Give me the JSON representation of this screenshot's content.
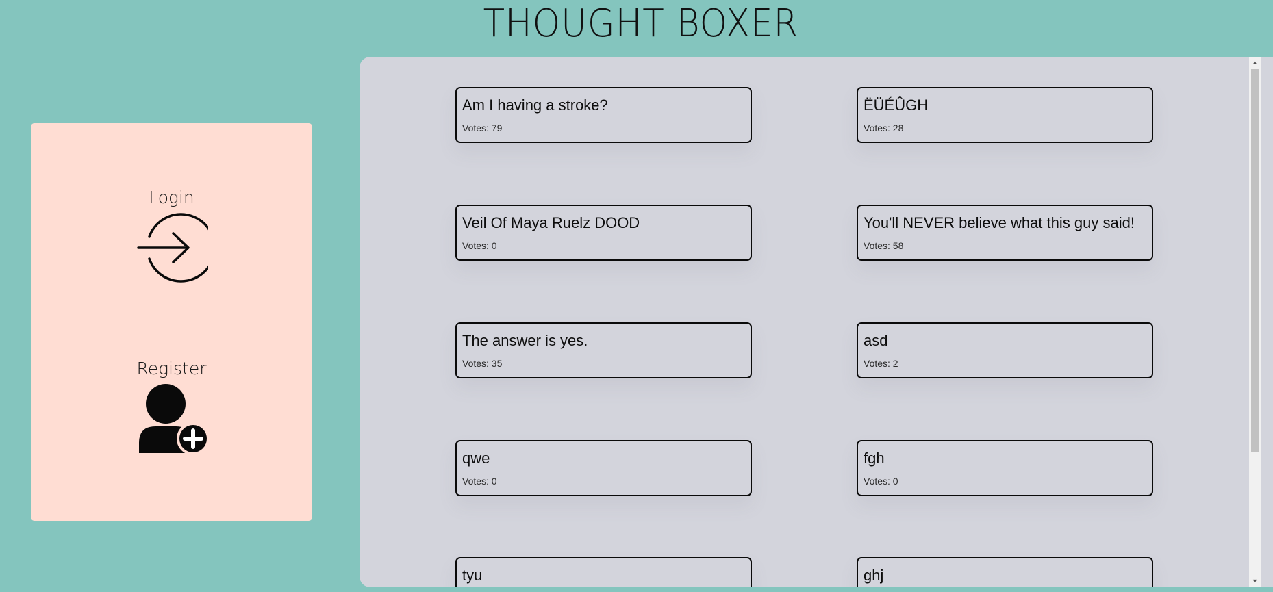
{
  "app": {
    "title": "THOUGHT BOXER"
  },
  "auth": {
    "login_label": "Login",
    "login_icon": "login-arrow-icon",
    "register_label": "Register",
    "register_icon": "add-user-icon"
  },
  "posts": [
    {
      "title": "Am I having a stroke?",
      "votes": "Votes: 79"
    },
    {
      "title": "ËÜÉÛGH",
      "votes": "Votes: 28"
    },
    {
      "title": "Veil Of Maya Ruelz DOOD",
      "votes": "Votes: 0"
    },
    {
      "title": "You'll NEVER believe what this guy said!",
      "votes": "Votes: 58"
    },
    {
      "title": "The answer is yes.",
      "votes": "Votes: 35"
    },
    {
      "title": "asd",
      "votes": "Votes: 2"
    },
    {
      "title": "qwe",
      "votes": "Votes: 0"
    },
    {
      "title": "fgh",
      "votes": "Votes: 0"
    },
    {
      "title": "tyu",
      "votes": ""
    },
    {
      "title": "ghj",
      "votes": ""
    }
  ],
  "colors": {
    "page_background": "#84c5be",
    "auth_panel": "#ffddd3",
    "feed_background": "#d3d4dc",
    "card_border": "#0a0a0a"
  }
}
